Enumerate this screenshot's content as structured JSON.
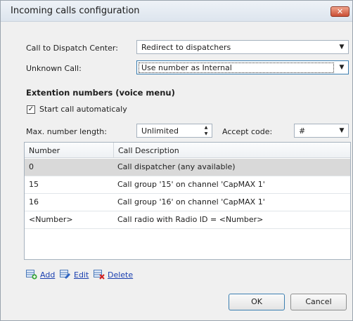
{
  "window": {
    "title": "Incoming calls configuration",
    "close_glyph": "✕"
  },
  "form": {
    "dispatch_label": "Call to Dispatch Center:",
    "dispatch_value": "Redirect to dispatchers",
    "unknown_label": "Unknown Call:",
    "unknown_value": "Use number as Internal",
    "section_title": "Extention numbers (voice menu)",
    "start_call_label": "Start call automaticaly",
    "start_call_checked": true,
    "max_length_label": "Max. number length:",
    "max_length_value": "Unlimited",
    "accept_code_label": "Accept code:",
    "accept_code_value": "#"
  },
  "grid": {
    "columns": [
      "Number",
      "Call Description"
    ],
    "rows": [
      {
        "number": "0",
        "description": "Call dispatcher (any available)",
        "selected": true
      },
      {
        "number": "15",
        "description": "Call group '15' on channel 'CapMAX 1'",
        "selected": false
      },
      {
        "number": "16",
        "description": "Call group '16' on channel 'CapMAX 1'",
        "selected": false
      },
      {
        "number": "<Number>",
        "description": "Call radio with Radio ID = <Number>",
        "selected": false
      }
    ]
  },
  "actions": {
    "add": "Add",
    "edit": "Edit",
    "delete": "Delete"
  },
  "buttons": {
    "ok": "OK",
    "cancel": "Cancel"
  },
  "icons": {
    "add": "add-row-icon",
    "edit": "edit-row-icon",
    "delete": "delete-row-icon"
  },
  "colors": {
    "link": "#1a3fb0",
    "close": "#c94e35",
    "selected_row": "#d9d9d9"
  }
}
